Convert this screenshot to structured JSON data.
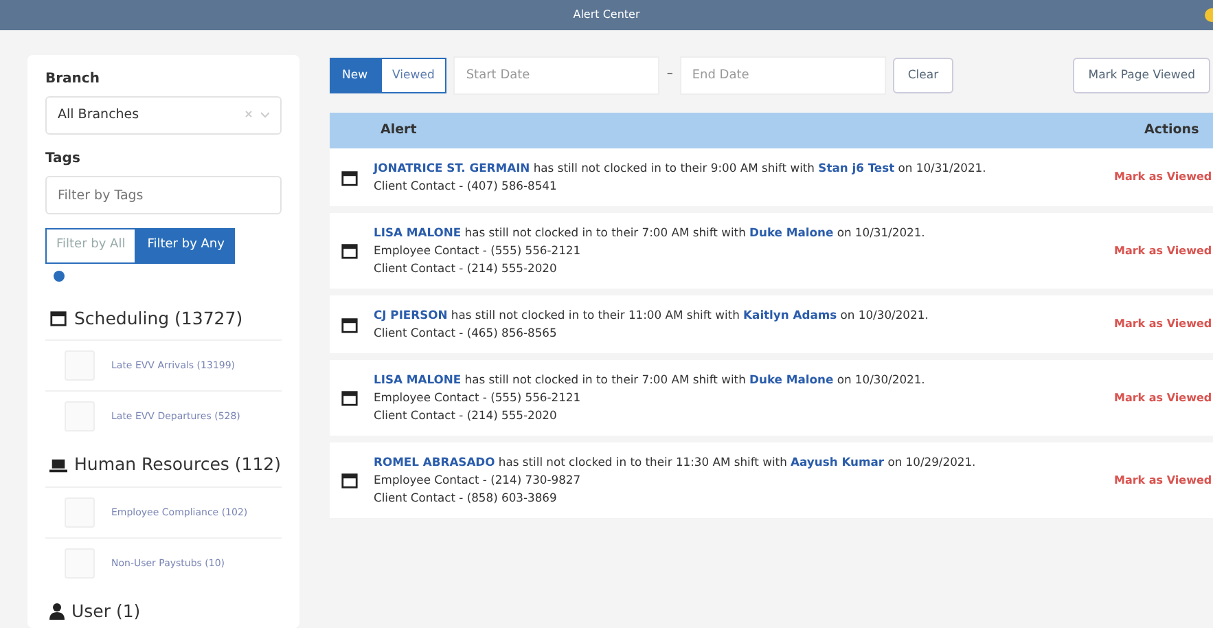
{
  "window": {
    "title": "Alert Center"
  },
  "sidebar": {
    "branch": {
      "label": "Branch",
      "value": "All Branches"
    },
    "tags": {
      "label": "Tags",
      "placeholder": "Filter by Tags"
    },
    "filter_modes": [
      {
        "label": "Filter by All",
        "selected": false
      },
      {
        "label": "Filter by Any",
        "selected": true
      }
    ],
    "categories": [
      {
        "kind": "calendar",
        "title": "Scheduling (13727)",
        "items": [
          {
            "label": "Late EVV Arrivals (13199)",
            "checked": false
          },
          {
            "label": "Late EVV Departures (528)",
            "checked": false
          }
        ]
      },
      {
        "kind": "desk",
        "title": "Human Resources (112)",
        "items": [
          {
            "label": "Employee Compliance (102)",
            "checked": false
          },
          {
            "label": "Non-User Paystubs (10)",
            "checked": false
          }
        ]
      },
      {
        "kind": "user",
        "title": "User (1)"
      }
    ]
  },
  "toolbar": {
    "status_tabs": [
      {
        "label": "New",
        "selected": true
      },
      {
        "label": "Viewed",
        "selected": false
      }
    ],
    "start_date": {
      "placeholder": "Start Date"
    },
    "separator": "–",
    "end_date": {
      "placeholder": "End Date"
    },
    "clear": "Clear",
    "mark_page": "Mark Page Viewed"
  },
  "table": {
    "columns": [
      "Alert",
      "Actions"
    ],
    "rows": [
      {
        "message": "**JONATRICE ST. GERMAIN** has still not clocked in to their 9:00 AM shift with **Stan j6 Test** on 10/31/2021.",
        "contacts": [
          "Client Contact - (407) 586-8541"
        ],
        "action": "Mark as Viewed"
      },
      {
        "message": "**LISA MALONE** has still not clocked in to their 7:00 AM shift with **Duke Malone** on 10/31/2021.",
        "contacts": [
          "Employee Contact - (555) 556-2121",
          "Client Contact - (214) 555-2020"
        ],
        "action": "Mark as Viewed"
      },
      {
        "message": "**CJ PIERSON** has still not clocked in to their 11:00 AM shift with **Kaitlyn Adams** on 10/30/2021.",
        "contacts": [
          "Client Contact - (465) 856-8565"
        ],
        "action": "Mark as Viewed"
      },
      {
        "message": "**LISA MALONE** has still not clocked in to their 7:00 AM shift with **Duke Malone** on 10/30/2021.",
        "contacts": [
          "Employee Contact - (555) 556-2121",
          "Client Contact - (214) 555-2020"
        ],
        "action": "Mark as Viewed"
      },
      {
        "message": "**ROMEL ABRASADO** has still not clocked in to their 11:30 AM shift with **Aayush Kumar** on 10/29/2021.",
        "contacts": [
          "Employee Contact - (214) 730-9827",
          "Client Contact - (858) 603-3869"
        ],
        "action": "Mark as Viewed"
      }
    ]
  }
}
